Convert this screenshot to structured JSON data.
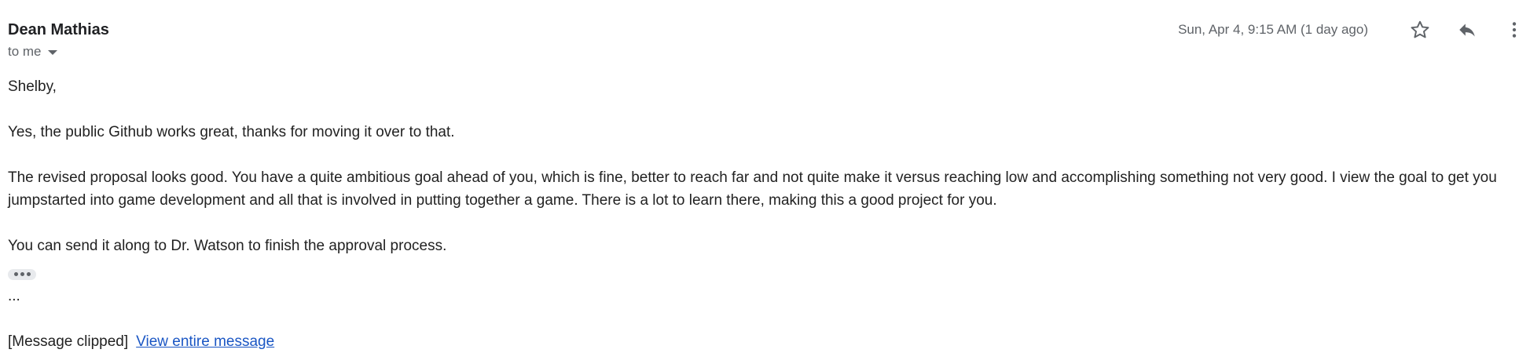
{
  "message": {
    "sender_name": "Dean Mathias",
    "recipient_label": "to me",
    "date": "Sun, Apr 4, 9:15 AM (1 day ago)",
    "body": {
      "greeting": "Shelby,",
      "paragraphs": [
        "Yes, the public Github works great, thanks for moving it over to that.",
        "The revised proposal looks good.  You have a quite ambitious goal ahead of you, which is fine, better to reach far and not quite make it versus reaching low and accomplishing something not very good.  I view the goal to get you jumpstarted into game development and all that is involved in putting together a game.  There is a lot to learn there, making this a good project for you.",
        "You can send it along to Dr. Watson to finish the approval process."
      ],
      "trailing": "...",
      "clipped_notice": "[Message clipped]",
      "view_entire_link": "View entire message"
    }
  },
  "icons": {
    "star": "star-icon",
    "reply": "reply-icon",
    "more": "more-vert-icon",
    "caret": "caret-down-icon",
    "expand": "show-trimmed-content-icon"
  },
  "colors": {
    "text": "#222222",
    "muted": "#5f6368",
    "link": "#1a56c4",
    "chip_bg": "#e8eaed"
  }
}
